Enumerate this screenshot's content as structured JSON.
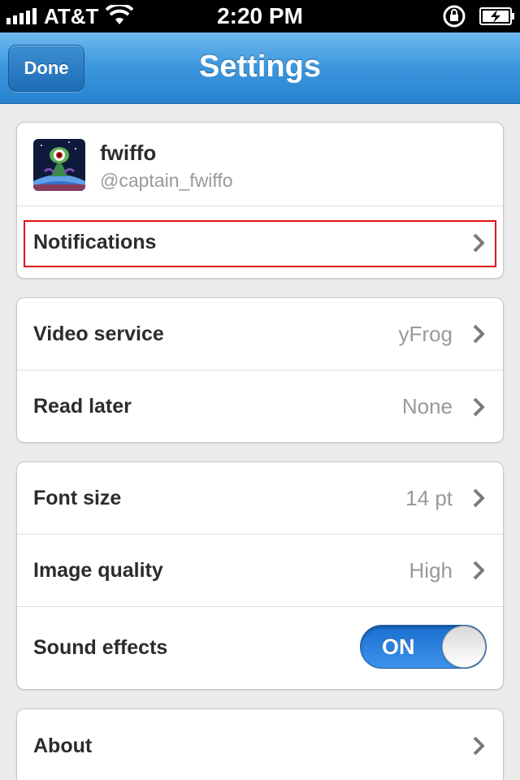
{
  "status_bar": {
    "carrier": "AT&T",
    "time": "2:20 PM"
  },
  "nav": {
    "done_label": "Done",
    "title": "Settings"
  },
  "account": {
    "name": "fwiffo",
    "handle": "@captain_fwiffo",
    "notifications_label": "Notifications"
  },
  "media": {
    "video_service_label": "Video service",
    "video_service_value": "yFrog",
    "read_later_label": "Read later",
    "read_later_value": "None"
  },
  "display": {
    "font_size_label": "Font size",
    "font_size_value": "14 pt",
    "image_quality_label": "Image quality",
    "image_quality_value": "High",
    "sound_effects_label": "Sound effects",
    "sound_effects_state": "ON"
  },
  "about": {
    "label": "About"
  },
  "colors": {
    "nav_blue": "#3b96dd",
    "toggle_blue": "#2a80dd",
    "highlight_red": "#e01010"
  }
}
